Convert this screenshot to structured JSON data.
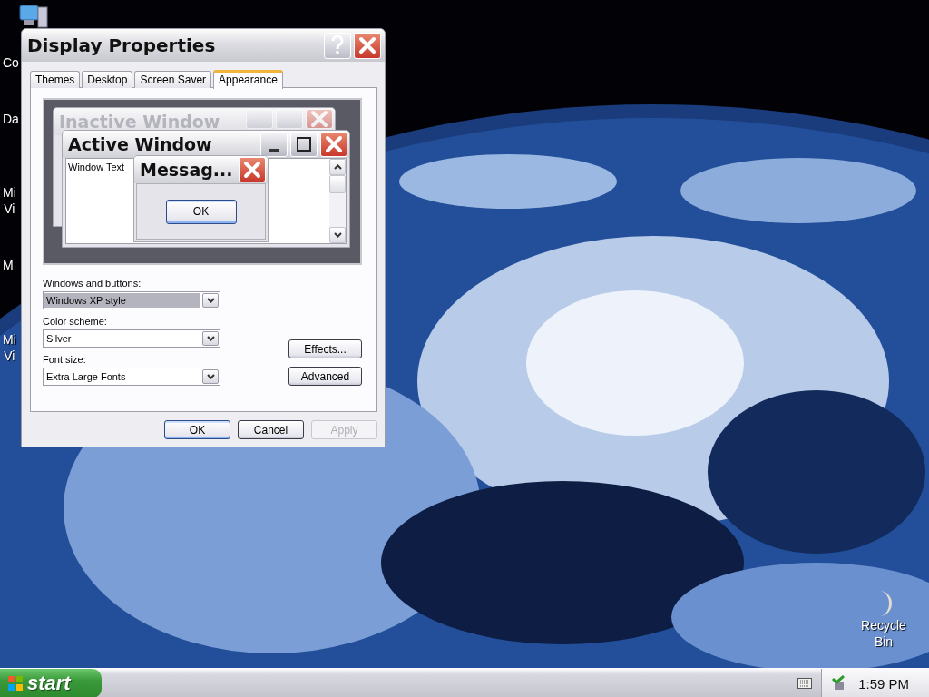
{
  "desktop": {
    "icons": [
      {
        "lines": [
          "Co"
        ]
      },
      {
        "lines": [
          "Da"
        ]
      },
      {
        "lines": [
          "Mi",
          "Vi"
        ]
      },
      {
        "lines": [
          "M"
        ]
      },
      {
        "lines": [
          "Mi",
          "Vi"
        ]
      }
    ],
    "recycle_bin": {
      "lines": [
        "Recycle",
        "Bin"
      ]
    }
  },
  "dialog": {
    "title": "Display Properties",
    "tabs": [
      {
        "label": "Themes",
        "selected": false
      },
      {
        "label": "Desktop",
        "selected": false
      },
      {
        "label": "Screen Saver",
        "selected": false
      },
      {
        "label": "Appearance",
        "selected": true
      }
    ],
    "preview": {
      "inactive_title": "Inactive Window",
      "active_title": "Active Window",
      "window_text": "Window Text",
      "message_title": "Messag...",
      "message_button": "OK"
    },
    "fields": [
      {
        "label": "Windows and buttons:",
        "value": "Windows XP style",
        "highlighted": true
      },
      {
        "label": "Color scheme:",
        "value": "Silver",
        "highlighted": false
      },
      {
        "label": "Font size:",
        "value": "Extra Large Fonts",
        "highlighted": false
      }
    ],
    "side_buttons": [
      "Effects...",
      "Advanced"
    ],
    "buttons": [
      {
        "label": "OK",
        "default": true,
        "disabled": false
      },
      {
        "label": "Cancel",
        "default": false,
        "disabled": false
      },
      {
        "label": "Apply",
        "default": false,
        "disabled": true
      }
    ]
  },
  "taskbar": {
    "start": "start",
    "clock": "1:59 PM"
  }
}
